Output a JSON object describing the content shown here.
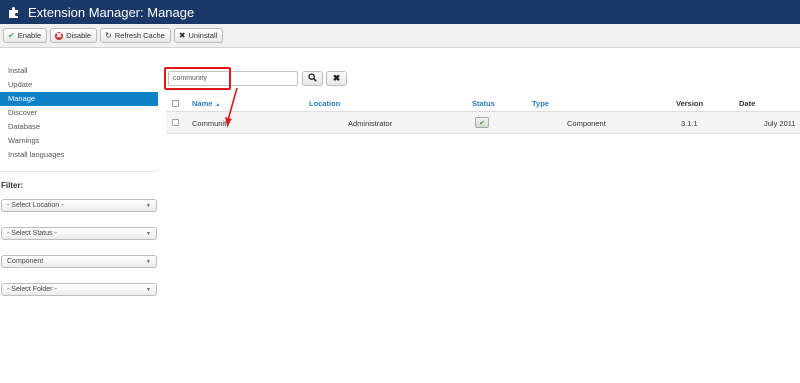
{
  "header": {
    "title": "Extension Manager: Manage",
    "logo_icon": "puzzle-icon"
  },
  "toolbar": {
    "enable_label": "Enable",
    "disable_label": "Disable",
    "refresh_label": "Refresh Cache",
    "uninstall_label": "Uninstall"
  },
  "sidebar": {
    "items": [
      {
        "label": "Install"
      },
      {
        "label": "Update"
      },
      {
        "label": "Manage"
      },
      {
        "label": "Discover"
      },
      {
        "label": "Database"
      },
      {
        "label": "Warnings"
      },
      {
        "label": "Install languages"
      }
    ],
    "active_item": "Manage"
  },
  "filter": {
    "label": "Filter:",
    "location": "- Select Location -",
    "status": "- Select Status -",
    "type": "Component",
    "folder": "- Select Folder -"
  },
  "search": {
    "value": "community"
  },
  "table": {
    "headers": {
      "name": "Name",
      "location": "Location",
      "status": "Status",
      "type": "Type",
      "version": "Version",
      "date": "Date"
    },
    "rows": [
      {
        "name": "Community",
        "location": "Administrator",
        "type": "Component",
        "version": "3.1.1",
        "date": "July 2011",
        "enabled": true
      }
    ]
  },
  "colors": {
    "header_bg": "#1a3867",
    "active_nav": "#0e82c8",
    "link": "#2480c2",
    "highlight": "#e01818"
  }
}
